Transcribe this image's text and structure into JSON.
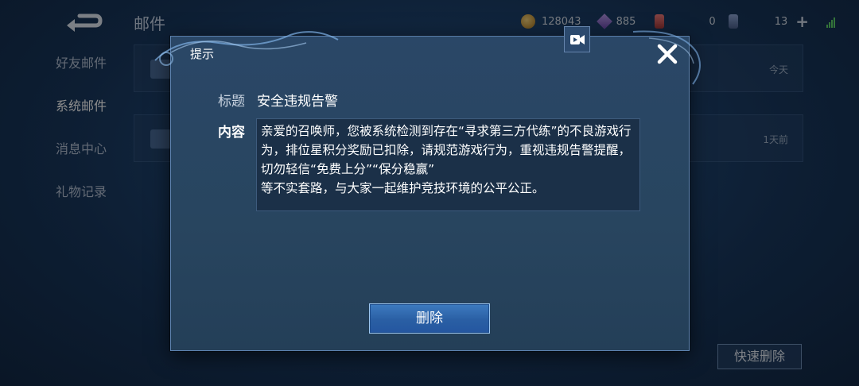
{
  "background": {
    "page_title": "邮件",
    "topbar": {
      "gold": "128043",
      "gems": "885",
      "tickets": "0",
      "level": "13"
    },
    "sidebar": [
      {
        "label": "好友邮件"
      },
      {
        "label": "系统邮件",
        "active": true
      },
      {
        "label": "消息中心"
      },
      {
        "label": "礼物记录"
      }
    ],
    "mails": [
      {
        "time": "今天"
      },
      {
        "time": "1天前"
      }
    ],
    "quick_delete_label": "快速删除"
  },
  "dialog": {
    "title": "提示",
    "subject_label": "标题",
    "subject_value": "安全违规告警",
    "content_label": "内容",
    "content_text": "亲爱的召唤师，您被系统检测到存在“寻求第三方代练”的不良游戏行为，排位星积分奖励已扣除，请规范游戏行为，重视违规告警提醒，切勿轻信“免费上分”“保分稳赢”\n等不实套路，与大家一起维护竞技环境的公平公正。",
    "delete_label": "删除"
  },
  "icons": {
    "record": "video-record-icon",
    "close": "close-icon",
    "back": "back-arrow-icon"
  },
  "colors": {
    "accent": "#2a5fa4",
    "dialog_bg": "#28455f"
  }
}
